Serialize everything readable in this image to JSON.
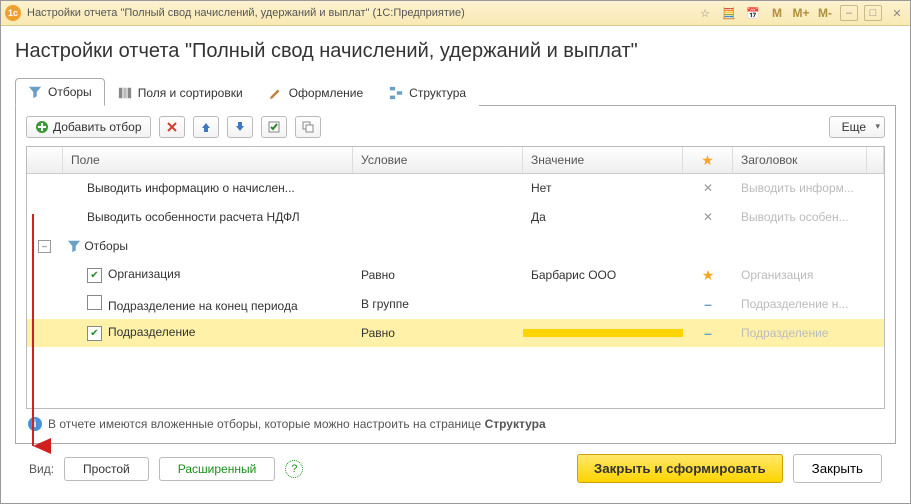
{
  "titlebar": {
    "title": "Настройки отчета \"Полный свод начислений, удержаний и выплат\"  (1С:Предприятие)",
    "mem": [
      "M",
      "M+",
      "M-"
    ]
  },
  "heading": "Настройки отчета \"Полный свод начислений, удержаний и выплат\"",
  "tabs": {
    "filters": "Отборы",
    "fields": "Поля и сортировки",
    "appearance": "Оформление",
    "structure": "Структура"
  },
  "toolbar": {
    "add": "Добавить отбор",
    "more": "Еще"
  },
  "grid": {
    "headers": {
      "field": "Поле",
      "cond": "Условие",
      "value": "Значение",
      "title": "Заголовок"
    },
    "rows": [
      {
        "field": "Выводить информацию о начислен...",
        "cond": "",
        "value": "Нет",
        "star": "x",
        "title": "Выводить информ..."
      },
      {
        "field": "Выводить особенности расчета НДФЛ",
        "cond": "",
        "value": "Да",
        "star": "x",
        "title": "Выводить особен..."
      },
      {
        "field": "Отборы",
        "group": true
      },
      {
        "field": "Организация",
        "cond": "Равно",
        "value": "Барбарис ООО",
        "chk": true,
        "star": "star",
        "title": "Организация"
      },
      {
        "field": "Подразделение на конец периода",
        "cond": "В группе",
        "value": "",
        "chk": false,
        "star": "dash",
        "title": "Подразделение н..."
      },
      {
        "field": "Подразделение",
        "cond": "Равно",
        "value": "",
        "chk": true,
        "star": "dash",
        "title": "Подразделение",
        "hi": true
      }
    ]
  },
  "info": {
    "text_a": "В отчете имеются вложенные отборы, которые можно настроить на странице ",
    "text_b": "Структура"
  },
  "footer": {
    "view_label": "Вид:",
    "simple": "Простой",
    "advanced": "Расширенный",
    "apply": "Закрыть и сформировать",
    "close": "Закрыть"
  }
}
